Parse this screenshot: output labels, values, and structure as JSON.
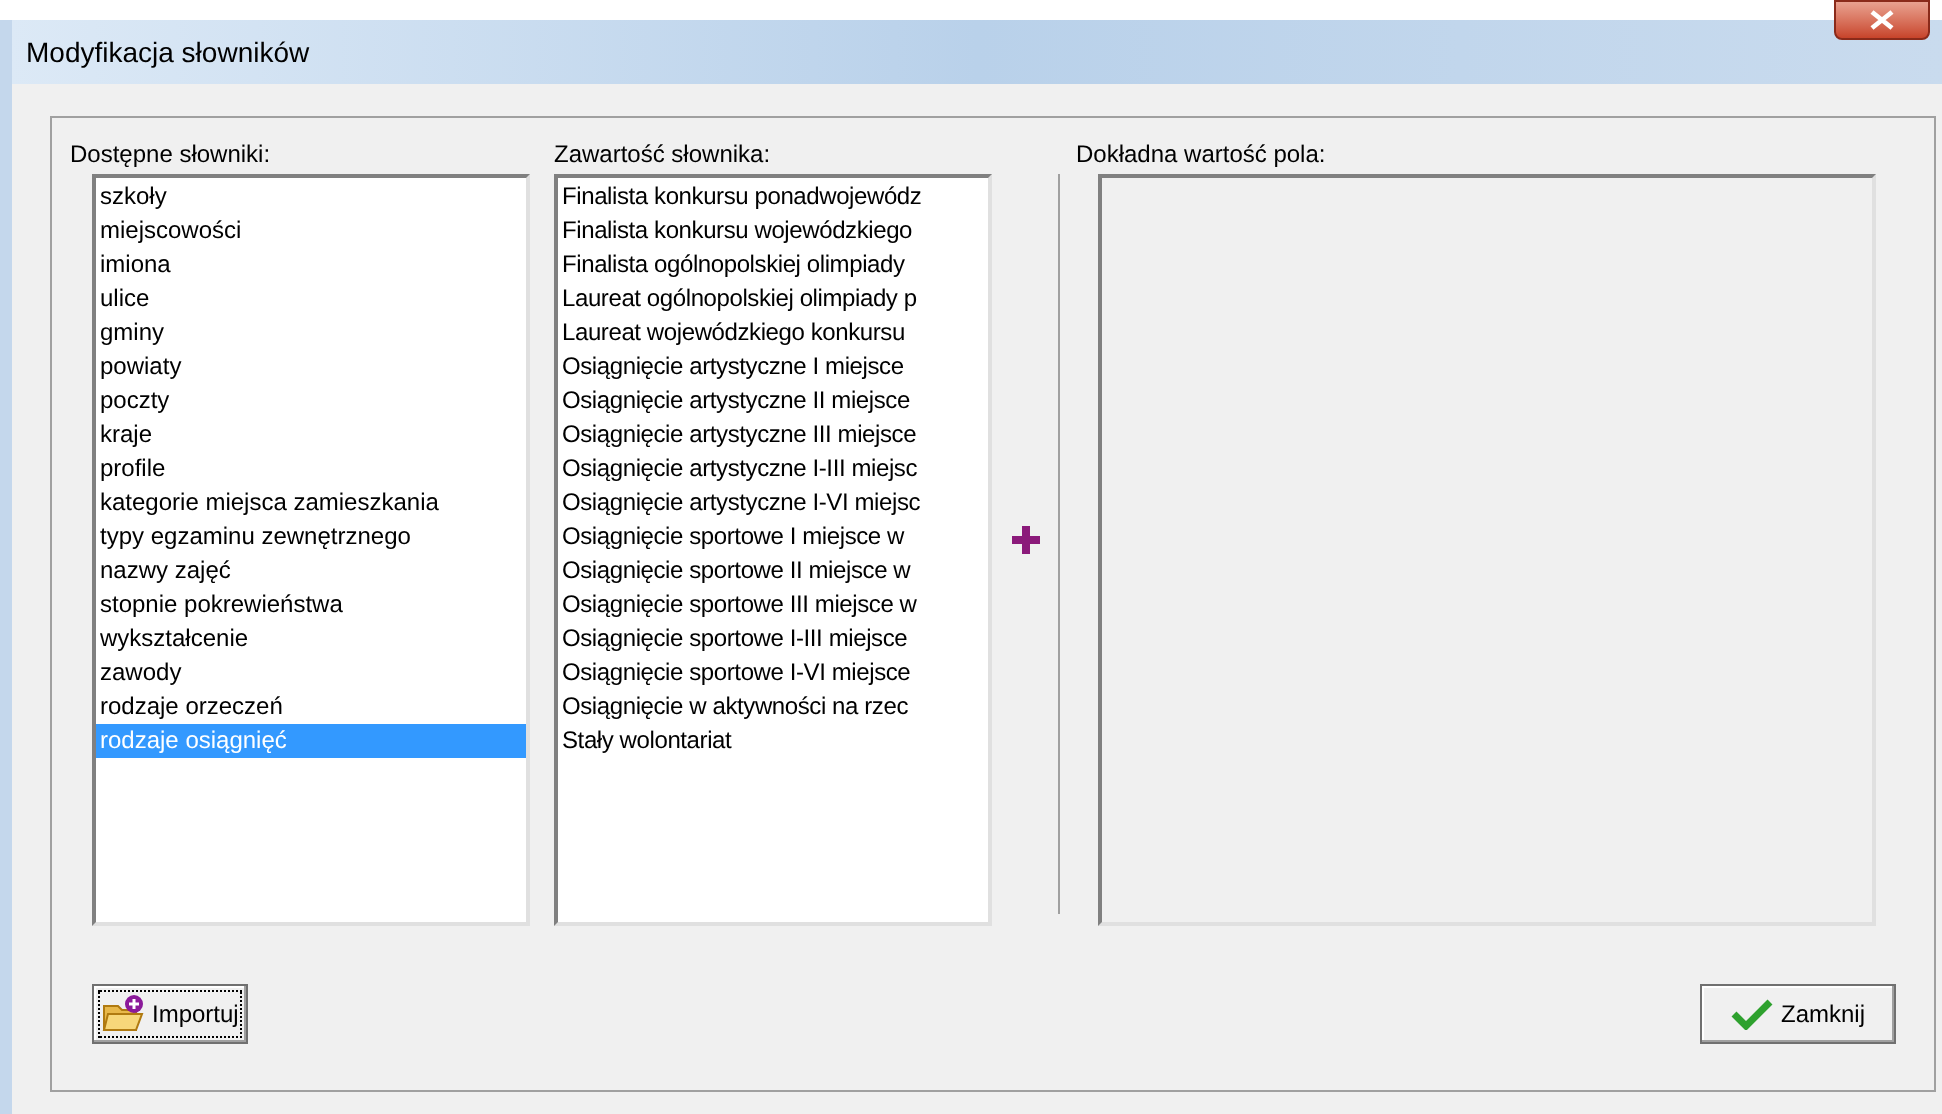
{
  "window": {
    "title": "Modyfikacja słowników"
  },
  "dictionaries": {
    "label": "Dostępne słowniki:",
    "items": [
      {
        "text": "szkoły",
        "selected": false
      },
      {
        "text": "miejscowości",
        "selected": false
      },
      {
        "text": "imiona",
        "selected": false
      },
      {
        "text": "ulice",
        "selected": false
      },
      {
        "text": "gminy",
        "selected": false
      },
      {
        "text": "powiaty",
        "selected": false
      },
      {
        "text": "poczty",
        "selected": false
      },
      {
        "text": "kraje",
        "selected": false
      },
      {
        "text": "profile",
        "selected": false
      },
      {
        "text": "kategorie miejsca zamieszkania",
        "selected": false
      },
      {
        "text": "typy egzaminu zewnętrznego",
        "selected": false
      },
      {
        "text": "nazwy zajęć",
        "selected": false
      },
      {
        "text": "stopnie pokrewieństwa",
        "selected": false
      },
      {
        "text": "wykształcenie",
        "selected": false
      },
      {
        "text": "zawody",
        "selected": false
      },
      {
        "text": "rodzaje orzeczeń",
        "selected": false
      },
      {
        "text": "rodzaje osiągnięć",
        "selected": true
      }
    ]
  },
  "contents": {
    "label": "Zawartość słownika:",
    "items": [
      "Finalista konkursu ponadwojewódz",
      "Finalista konkursu wojewódzkiego",
      "Finalista ogólnopolskiej olimpiady",
      "Laureat ogólnopolskiej olimpiady p",
      "Laureat wojewódzkiego konkursu",
      "Osiągnięcie artystyczne I miejsce",
      "Osiągnięcie artystyczne II miejsce",
      "Osiągnięcie artystyczne III miejsce",
      "Osiągnięcie artystyczne I-III miejsc",
      "Osiągnięcie artystyczne I-VI miejsc",
      "Osiągnięcie sportowe I miejsce w",
      "Osiągnięcie sportowe II miejsce w",
      "Osiągnięcie sportowe III miejsce w",
      "Osiągnięcie sportowe I-III miejsce",
      "Osiągnięcie sportowe I-VI miejsce",
      "Osiągnięcie w aktywności na rzec",
      "Stały wolontariat"
    ]
  },
  "value_field": {
    "label": "Dokładna wartość pola:"
  },
  "buttons": {
    "import": "Importuj",
    "close": "Zamknij"
  }
}
